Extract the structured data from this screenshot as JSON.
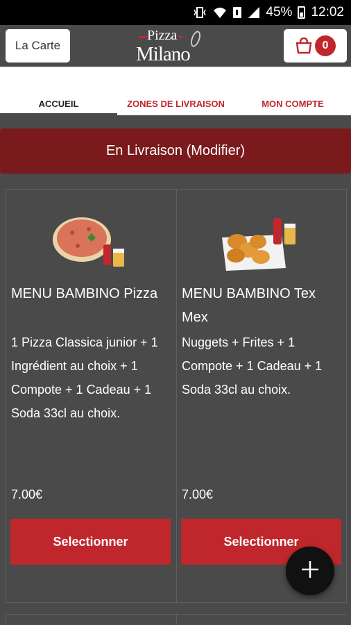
{
  "status_bar": {
    "battery": "45%",
    "time": "12:02"
  },
  "header": {
    "carte_label": "La Carte",
    "logo_top": "Pizza",
    "logo_bottom": "Milano",
    "cart_count": "0"
  },
  "tabs": [
    {
      "label": "ACCUEIL",
      "active": true
    },
    {
      "label": "ZONES DE LIVRAISON",
      "active": false
    },
    {
      "label": "MON COMPTE",
      "active": false
    }
  ],
  "delivery_banner": "En Livraison (Modifier)",
  "menu_items": [
    {
      "title": "MENU BAMBINO Pizza",
      "description": "1 Pizza Classica junior  + 1 Ingrédient au choix  + 1 Compote  + 1 Cadeau  + 1 Soda 33cl au choix.",
      "price": "7.00€",
      "button": "Selectionner",
      "image": "pizza-with-soda"
    },
    {
      "title": "MENU BAMBINO Tex Mex",
      "description": "Nuggets  + Frites  + 1 Compote  + 1 Cadeau  + 1 Soda 33cl au choix.",
      "price": "7.00€",
      "button": "Selectionner",
      "image": "nuggets-with-soda"
    }
  ],
  "colors": {
    "accent": "#c0272d",
    "banner": "#7a1a1c",
    "background": "#4a4a4a"
  }
}
